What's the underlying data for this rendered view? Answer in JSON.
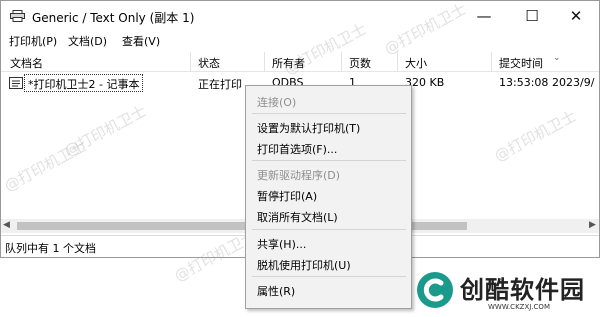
{
  "window": {
    "title": "Generic / Text Only (副本 1)",
    "controls": {
      "minimize": "—",
      "maximize": "☐",
      "close": "✕"
    }
  },
  "menubar": [
    "打印机(P)",
    "文档(D)",
    "查看(V)"
  ],
  "columns": [
    "文档名",
    "状态",
    "所有者",
    "页数",
    "大小",
    "提交时间"
  ],
  "job": {
    "name": "*打印机卫士2 - 记事本",
    "status": "正在打印",
    "owner": "ODBS",
    "pages": "1",
    "size": "320 KB",
    "time": "13:53:08",
    "date": "2023/9/"
  },
  "status_bar": "队列中有 1 个文档",
  "context_menu": [
    {
      "label": "连接(O)",
      "enabled": false
    },
    {
      "label": "设置为默认打印机(T)",
      "enabled": true
    },
    {
      "label": "打印首选项(F)...",
      "enabled": true
    },
    {
      "label": "更新驱动程序(D)",
      "enabled": false
    },
    {
      "label": "暂停打印(A)",
      "enabled": true
    },
    {
      "label": "取消所有文档(L)",
      "enabled": true
    },
    {
      "label": "共享(H)...",
      "enabled": true
    },
    {
      "label": "脱机使用打印机(U)",
      "enabled": true
    },
    {
      "label": "属性(R)",
      "enabled": true
    }
  ],
  "watermark": "@打印机卫士",
  "brand": {
    "name": "创酷软件园",
    "url": "WWW.CKZXJ.COM",
    "color": "#1a9a8a"
  }
}
